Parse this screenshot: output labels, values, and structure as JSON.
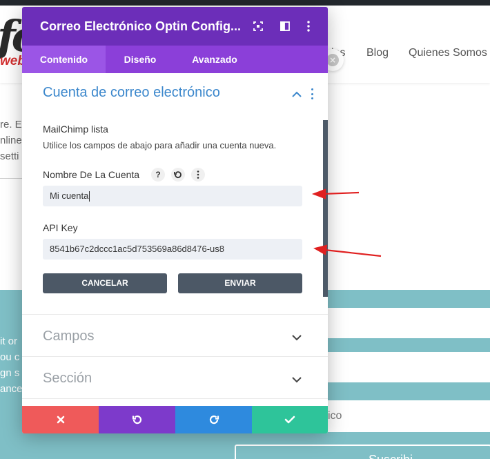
{
  "background": {
    "nav_items": [
      "Blog",
      "Quienes Somos"
    ],
    "nav_partial": "ios",
    "logo_partial": "fo",
    "logo_web": "web",
    "text_fragments": [
      "re. E",
      "nline",
      "setti"
    ],
    "teal_fragments": [
      "it or",
      "ou c",
      "gn s",
      "ance"
    ],
    "email_placeholder_partial": "ico",
    "subscribe_partial": "Suscribi"
  },
  "modal": {
    "title": "Correo Electrónico Optin Config...",
    "tabs": [
      {
        "label": "Contenido",
        "active": true
      },
      {
        "label": "Diseño",
        "active": false
      },
      {
        "label": "Avanzado",
        "active": false
      }
    ],
    "section_account": {
      "title": "Cuenta de correo electrónico",
      "list_label": "MailChimp lista",
      "list_description": "Utilice los campos de abajo para añadir una cuenta nueva.",
      "name_label": "Nombre De La Cuenta",
      "help_glyph": "?",
      "name_value": "Mi cuenta",
      "api_label": "API Key",
      "api_value": "8541b67c2dccc1ac5d753569a86d8476-us8",
      "cancel_label": "CANCELAR",
      "submit_label": "ENVIAR"
    },
    "sections_collapsed": [
      {
        "title": "Campos"
      },
      {
        "title": "Sección"
      }
    ],
    "colors": {
      "header": "#6c2eb9",
      "tabs": "#8b3fd9",
      "accent_blue": "#3b87cc",
      "footer_cancel": "#ef5a5a",
      "footer_undo": "#7d3acb",
      "footer_redo": "#2e8ade",
      "footer_save": "#2ec49a",
      "annotation_arrow": "#e02020"
    },
    "icons": [
      "fullscreen-icon",
      "split-view-icon",
      "more-vertical-icon",
      "close-x-icon",
      "undo-icon",
      "redo-icon",
      "checkmark-icon"
    ]
  }
}
